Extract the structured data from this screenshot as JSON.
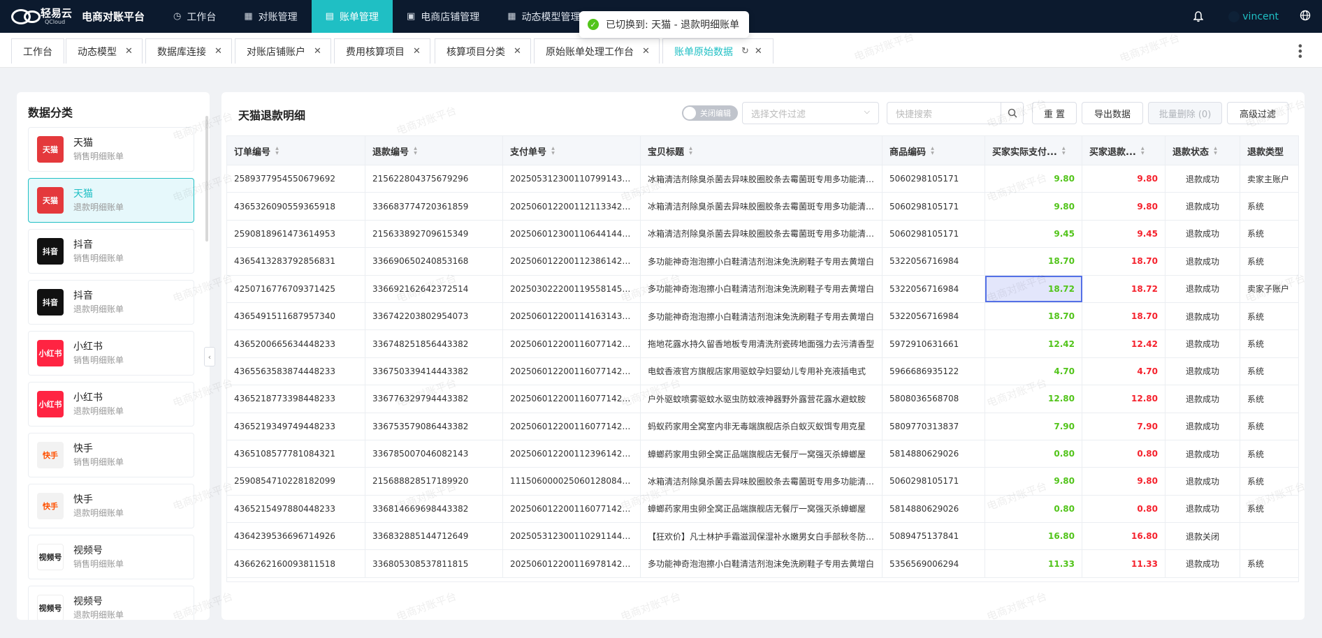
{
  "app": {
    "brand": "轻易云",
    "brand_sub": "QCloud",
    "title": "电商对账平台"
  },
  "nav": [
    {
      "label": "工作台",
      "icon": "clock-icon"
    },
    {
      "label": "对账管理",
      "icon": "grid-icon"
    },
    {
      "label": "账单管理",
      "icon": "book-icon",
      "active": true
    },
    {
      "label": "电商店铺管理",
      "icon": "shop-icon"
    },
    {
      "label": "动态模型管理",
      "icon": "table-icon"
    }
  ],
  "user": {
    "name": "vincent"
  },
  "toast": {
    "text": "已切换到: 天猫 - 退款明细账单"
  },
  "tabs": [
    {
      "label": "工作台",
      "closable": false
    },
    {
      "label": "动态模型",
      "closable": true
    },
    {
      "label": "数据库连接",
      "closable": true
    },
    {
      "label": "对账店铺账户",
      "closable": true
    },
    {
      "label": "费用核算项目",
      "closable": true
    },
    {
      "label": "核算项目分类",
      "closable": true
    },
    {
      "label": "原始账单处理工作台",
      "closable": true
    },
    {
      "label": "账单原始数据",
      "closable": true,
      "active": true
    }
  ],
  "sidebar": {
    "title": "数据分类",
    "items": [
      {
        "name": "天猫",
        "sub": "销售明细账单",
        "logo": "天猫",
        "color": "#e4393c"
      },
      {
        "name": "天猫",
        "sub": "退款明细账单",
        "logo": "天猫",
        "color": "#e4393c",
        "active": true
      },
      {
        "name": "抖音",
        "sub": "销售明细账单",
        "logo": "抖音",
        "color": "#111111"
      },
      {
        "name": "抖音",
        "sub": "退款明细账单",
        "logo": "抖音",
        "color": "#111111"
      },
      {
        "name": "小红书",
        "sub": "销售明细账单",
        "logo": "小红书",
        "color": "#ff2442"
      },
      {
        "name": "小红书",
        "sub": "退款明细账单",
        "logo": "小红书",
        "color": "#ff2442"
      },
      {
        "name": "快手",
        "sub": "销售明细账单",
        "logo": "快手",
        "color": "#f2f2f2"
      },
      {
        "name": "快手",
        "sub": "退款明细账单",
        "logo": "快手",
        "color": "#f2f2f2"
      },
      {
        "name": "视频号",
        "sub": "销售明细账单",
        "logo": "视频号",
        "color": "#ffffff"
      },
      {
        "name": "视频号",
        "sub": "退款明细账单",
        "logo": "视频号",
        "color": "#ffffff"
      }
    ]
  },
  "main": {
    "title": "天猫退款明细",
    "switch_label": "关闭编辑",
    "file_filter_placeholder": "选择文件过滤",
    "search_placeholder": "快捷搜索",
    "buttons": {
      "reset": "重 置",
      "export": "导出数据",
      "batch_delete": "批量删除 (0)",
      "advanced": "高级过滤"
    }
  },
  "table": {
    "columns": [
      "订单编号",
      "退款编号",
      "支付单号",
      "宝贝标题",
      "商品编码",
      "买家实际支付...",
      "买家退款...",
      "退款状态",
      "退款类型"
    ],
    "rows": [
      [
        "2589377954550679692",
        "215622804375679296",
        "2025053123001107991436...",
        "冰箱清洁剂除臭杀菌去异味胶圈胶条去霉菌斑专用多功能清洗剂",
        "5060298105171",
        "9.80",
        "9.80",
        "退款成功",
        "卖家主账户"
      ],
      [
        "4365326090559365918",
        "336683774720361859",
        "2025060122001121133428...",
        "冰箱清洁剂除臭杀菌去异味胶圈胶条去霉菌斑专用多功能清洗剂",
        "5060298105171",
        "9.80",
        "9.80",
        "退款成功",
        "系统"
      ],
      [
        "2590818961473614953",
        "215633892709615349",
        "2025060123001106441447...",
        "冰箱清洁剂除臭杀菌去异味胶圈胶条去霉菌斑专用多功能清洗剂",
        "5060298105171",
        "9.45",
        "9.45",
        "退款成功",
        "系统"
      ],
      [
        "4365413283792856831",
        "336690650240853168",
        "2025060122001123861427...",
        "多功能神奇泡泡擦小白鞋清洁剂泡沫免洗刷鞋子专用去黄增白",
        "5322056716984",
        "18.70",
        "18.70",
        "退款成功",
        "系统"
      ],
      [
        "4250716776709371425",
        "336692162642372514",
        "2025030222001195581457...",
        "多功能神奇泡泡擦小白鞋清洁剂泡沫免洗刷鞋子专用去黄增白",
        "5322056716984",
        "18.72",
        "18.72",
        "退款成功",
        "卖家子账户"
      ],
      [
        "4365491511687957340",
        "336742203802954073",
        "2025060122001141631437...",
        "多功能神奇泡泡擦小白鞋清洁剂泡沫免洗刷鞋子专用去黄增白",
        "5322056716984",
        "18.70",
        "18.70",
        "退款成功",
        "系统"
      ],
      [
        "4365200665634448233",
        "336748251856443382",
        "2025060122001160771427...",
        "拖地花露水持久留香地板专用清洗剂瓷砖地面强力去污清香型",
        "5972910631661",
        "12.42",
        "12.42",
        "退款成功",
        "系统"
      ],
      [
        "4365563583874448233",
        "336750339414443382",
        "2025060122001160771427...",
        "电蚊香液官方旗舰店家用驱蚊孕妇婴幼儿专用补充液插电式",
        "5966686935122",
        "4.70",
        "4.70",
        "退款成功",
        "系统"
      ],
      [
        "4365218773398448233",
        "336776329794443382",
        "2025060122001160771427...",
        "户外驱蚊喷雾驱蚊水驱虫防蚊液神器野外露营花露水避蚊胺",
        "5808036568708",
        "12.80",
        "12.80",
        "退款成功",
        "系统"
      ],
      [
        "4365219349749448233",
        "336753579086443382",
        "2025060122001160771427...",
        "蚂蚁药家用全窝室内非无毒端旗舰店杀白蚁灭蚁饵专用克星",
        "5809770313837",
        "7.90",
        "7.90",
        "退款成功",
        "系统"
      ],
      [
        "4365108577781084321",
        "336785007046082143",
        "2025060122001123961427...",
        "蟑螂药家用虫卵全窝正品端旗舰店无餐厅一窝强灭杀蟑螂屋",
        "5814880629026",
        "0.80",
        "0.80",
        "退款成功",
        "系统"
      ],
      [
        "2590854710228182099",
        "215688828517189920",
        "1115060000250601280840...",
        "冰箱清洁剂除臭杀菌去异味胶圈胶条去霉菌斑专用多功能清洗剂",
        "5060298105171",
        "9.80",
        "9.80",
        "退款成功",
        "系统"
      ],
      [
        "4365215497880448233",
        "336814669698443382",
        "2025060122001160771427...",
        "蟑螂药家用虫卵全窝正品端旗舰店无餐厅一窝强灭杀蟑螂屋",
        "5814880629026",
        "0.80",
        "0.80",
        "退款成功",
        "系统"
      ],
      [
        "4364239536696714926",
        "336832885144712649",
        "2025053123001102911447...",
        "【狂欢价】凡士林护手霜滋润保湿补水嫩男女白手部秋冬防干裂",
        "5089475137841",
        "16.80",
        "16.80",
        "退款关闭",
        ""
      ],
      [
        "4366262160093811518",
        "336805308537811815",
        "2025060122001169781427...",
        "多功能神奇泡泡擦小白鞋清洁剂泡沫免洗刷鞋子专用去黄增白",
        "5356569006294",
        "11.33",
        "11.33",
        "退款成功",
        "系统"
      ]
    ]
  },
  "watermark": "电商对账平台",
  "colors": {
    "nav_bg": "#0c1a2e",
    "accent": "#1fbfc4",
    "green": "#52c41a",
    "red": "#f5222d"
  }
}
